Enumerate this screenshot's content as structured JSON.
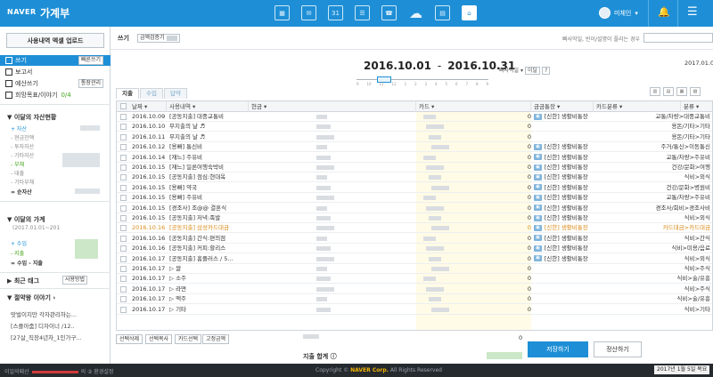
{
  "topbar": {
    "logo": "NAVER",
    "title": "가계부",
    "icons": [
      "calculator-icon",
      "piggybank-icon",
      "calendar-icon",
      "list-icon",
      "phone-icon",
      "cloud-icon",
      "receipt-icon",
      "home-icon"
    ],
    "icon_glyphs": [
      "▦",
      "✉",
      "31",
      "☰",
      "☎",
      "☁",
      "▤",
      "⌂"
    ],
    "user": "미체인",
    "bell_glyph": "🔔",
    "menu_glyph": "☰"
  },
  "sidebar": {
    "upload": "사용내역 엑셀 업로드",
    "nav": [
      {
        "label": "쓰기",
        "badge": "빠른쓰기"
      },
      {
        "label": "보고서"
      },
      {
        "label": "예산쓰기",
        "badge": "통장관리"
      },
      {
        "label": "희망목표/이야기",
        "extra": "0/4"
      }
    ],
    "assets": {
      "title": "이달의 자산현황",
      "rows": [
        "+ 자산",
        "- 현금잔액",
        "- 투자자산",
        "- 기타자산",
        "- 부채",
        "- 대출",
        "- 기타부채",
        "= 순자산"
      ]
    },
    "monthly": {
      "title": "이달의 가계",
      "period": "(2017.01.01~201",
      "rows": [
        "+ 수입",
        "- 지출",
        "= 수입 - 지출"
      ]
    },
    "tags": {
      "title": "최근 태그",
      "button": "사용방법"
    },
    "stories": {
      "title": "절약왕 이야기",
      "items": [
        "맛벌이지만 각자관리하는...",
        "[스플아줌] 디자이너 /12..",
        "[27살_직장4년차_1인가구..."
      ]
    }
  },
  "main": {
    "write_label": "쓰기",
    "write_btn": "금액검증기",
    "hint": "빠사막일, 빈이/설명이 플리는 경우",
    "date_start": "2016.10.01",
    "date_dash": "-",
    "date_end": "2016.10.31",
    "period_label": "빠사작일",
    "period_btn": "이달",
    "period_q": "?",
    "prev_date": "2017.01.0",
    "slider_nums": [
      "9",
      "10",
      "11",
      "12",
      "1",
      "2",
      "3",
      "4",
      "5",
      "6",
      "7",
      "8",
      "9"
    ],
    "tabs": [
      "지출",
      "수입",
      "답약"
    ],
    "view_btns": [
      "▥",
      "▤",
      "▦",
      "▧"
    ],
    "columns": [
      "날짜",
      "사용내역",
      "현금",
      "카드",
      "금금통장",
      "카드분류",
      "분류"
    ],
    "rows": [
      {
        "date": "2016.10.09",
        "desc": "[공동지출] 대중교통비",
        "cash": "0",
        "acct": "[신한] 생활비통장",
        "cat": "교통/차량>대중교통비"
      },
      {
        "date": "2016.10.10",
        "desc": "   무지출의 날 ♬",
        "cash": "0",
        "acct": "",
        "cat": "용돈/기타>기타"
      },
      {
        "date": "2016.10.11",
        "desc": "   무지출의 날 ♬",
        "cash": "0",
        "acct": "",
        "cat": "용돈/기타>기타"
      },
      {
        "date": "2016.10.12",
        "desc": "[용빠] 통신비",
        "cash": "0",
        "acct": "[신한] 생활비통장",
        "cat": "주거/통신>이동통신"
      },
      {
        "date": "2016.10.14",
        "desc": "[재느] 주유비",
        "cash": "0",
        "acct": "[신한] 생활비통장",
        "cat": "교통/차량>주유비"
      },
      {
        "date": "2016.10.15",
        "desc": "[재느] 일론여행숙박비",
        "cash": "0",
        "acct": "[신한] 생활비통장",
        "cat": "건강/문화>여행"
      },
      {
        "date": "2016.10.15",
        "desc": "[공동지출] 점심:현대옥",
        "cash": "0",
        "acct": "[신한] 생활비통장",
        "cat": "식비>외식"
      },
      {
        "date": "2016.10.15",
        "desc": "[용빠] 약국",
        "cash": "0",
        "acct": "[신한] 생활비통장",
        "cat": "건강/문화>병원비"
      },
      {
        "date": "2016.10.15",
        "desc": "[용빠] 주유비",
        "cash": "0",
        "acct": "[신한] 생활비통장",
        "cat": "교통/차량>주유비"
      },
      {
        "date": "2016.10.15",
        "desc": "[경조사] 조@@ 결혼식",
        "cash": "0",
        "acct": "[신한] 생활비통장",
        "cat": "경조사/회비>경조사비"
      },
      {
        "date": "2016.10.15",
        "desc": "[공동지출] 저녁:족발",
        "cash": "0",
        "acct": "[신한] 생활비통장",
        "cat": "식비>외식"
      },
      {
        "date": "2016.10.16",
        "desc": "[공동지출] 삼성카드대금",
        "cash": "0",
        "acct": "[신한] 생활비통장",
        "cat": "카드대금>카드대금",
        "orange": true
      },
      {
        "date": "2016.10.16",
        "desc": "[공동지출] 간식:편의점",
        "cash": "0",
        "acct": "[신한] 생활비통장",
        "cat": "식비>간식"
      },
      {
        "date": "2016.10.16",
        "desc": "[공동지출] 커피:할리스",
        "cash": "0",
        "acct": "[신한] 생활비통장",
        "cat": "식비>미용/음료"
      },
      {
        "date": "2016.10.17",
        "desc": "[공동지출] 홈플러스 / 5...",
        "cash": "0",
        "acct": "[신한] 생활비통장",
        "cat": "식비>외식"
      },
      {
        "date": "2016.10.17",
        "desc": "   ▷ 쌀",
        "cash": "0",
        "acct": "",
        "cat": "식비>주식"
      },
      {
        "date": "2016.10.17",
        "desc": "   ▷ 소주",
        "cash": "0",
        "acct": "",
        "cat": "식비>술/유흥"
      },
      {
        "date": "2016.10.17",
        "desc": "   ▷ 라면",
        "cash": "0",
        "acct": "",
        "cat": "식비>주식"
      },
      {
        "date": "2016.10.17",
        "desc": "   ▷ 맥주",
        "cash": "0",
        "acct": "",
        "cat": "식비>술/유흥"
      },
      {
        "date": "2016.10.17",
        "desc": "   ▷ 기타",
        "cash": "0",
        "acct": "",
        "cat": "식비>기타"
      }
    ],
    "bottom_btns": [
      "선택삭제",
      "선택복사",
      "카드선택",
      "고정금액"
    ],
    "bottom_zero": "0",
    "total_label": "지출 합계",
    "save": "저장하기",
    "settle": "정산하기"
  },
  "footer": {
    "left": "이일의패산",
    "left_mid": "의",
    "left_end": "② 환경설정",
    "copy_pre": "Copyright ©",
    "copy_brand": "NAVER Corp.",
    "copy_post": "All Rights Reserved",
    "date": "2017년 1월 5일 목요"
  },
  "colors": {
    "accent": "#1e8fd6",
    "green": "#44a51a",
    "orange": "#d98a18"
  }
}
